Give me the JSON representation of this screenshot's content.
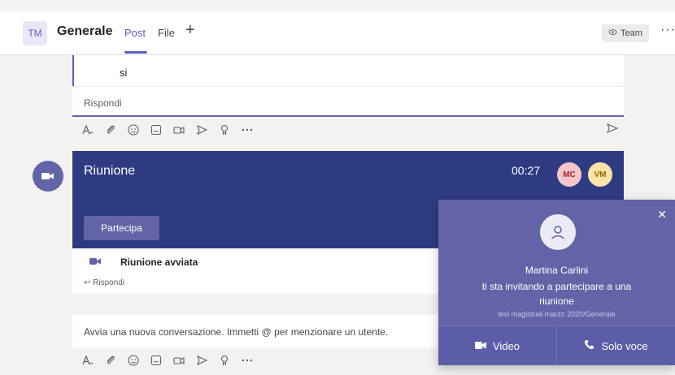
{
  "header": {
    "avatar": "TM",
    "channel": "Generale",
    "tabs": [
      {
        "label": "Post",
        "active": true
      },
      {
        "label": "File",
        "active": false
      }
    ],
    "add_tab": "+",
    "team_button": "Team",
    "more": "···"
  },
  "thread": {
    "message": "si",
    "reply_placeholder": "Rispondi"
  },
  "meeting": {
    "title": "Riunione",
    "duration": "00:27",
    "participants": [
      {
        "initials": "MC",
        "bg": "#f4c6c9",
        "fg": "#a4262c"
      },
      {
        "initials": "VM",
        "bg": "#fce3a8",
        "fg": "#8a6a00"
      }
    ],
    "join_label": "Partecipa",
    "started_label": "Riunione avviata",
    "reply_label": "Rispondi"
  },
  "new_conversation": {
    "placeholder": "Avvia una nuova conversazione. Immetti @ per menzionare un utente."
  },
  "toolbar_icons": [
    "format-icon",
    "attach-icon",
    "emoji-icon",
    "sticker-icon",
    "meet-now-icon",
    "send-forward-icon",
    "praise-icon",
    "more-icon"
  ],
  "invite": {
    "caller": "Martina Carlini",
    "message": "ti sta invitando a partecipare a una riunione",
    "context": "tesi magistrali marzo 2020/Generale",
    "video_label": "Video",
    "audio_label": "Solo voce"
  },
  "colors": {
    "accent": "#6264a7",
    "banner": "#2e3b83"
  }
}
